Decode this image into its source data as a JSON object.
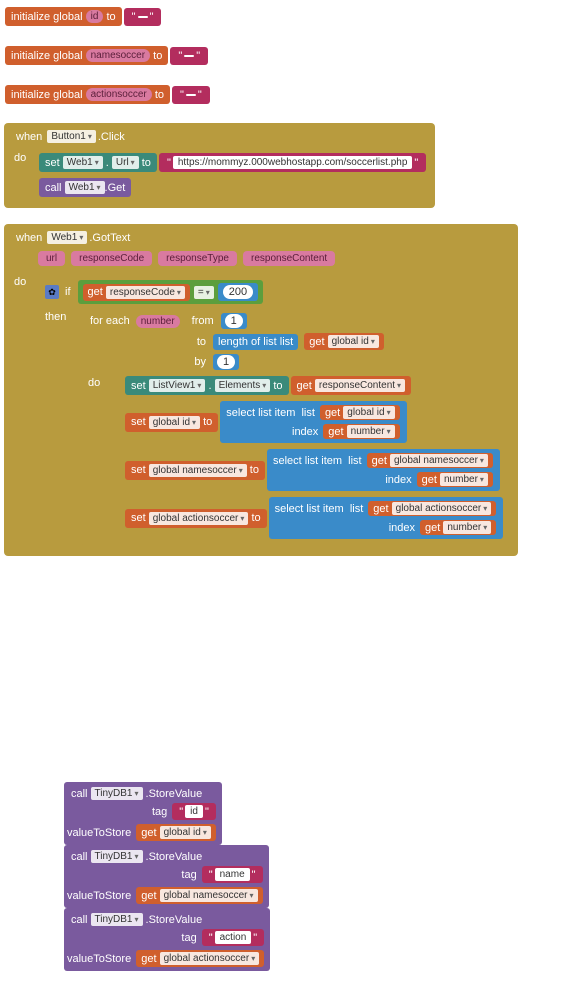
{
  "init": [
    {
      "label": "initialize global",
      "var": "id",
      "to": "to",
      "value": ""
    },
    {
      "label": "initialize global",
      "var": "namesoccer",
      "to": "to",
      "value": ""
    },
    {
      "label": "initialize global",
      "var": "actionsoccer",
      "to": "to",
      "value": ""
    }
  ],
  "event1": {
    "when": "when",
    "target": "Button1",
    "evt": ".Click",
    "do": "do",
    "set": "set",
    "web": "Web1",
    "prop": "Url",
    "to": "to",
    "url": "https://mommyz.000webhostapp.com/soccerlist.php",
    "call": "call",
    "callWeb": "Web1",
    "method": ".Get"
  },
  "event2": {
    "when": "when",
    "target": "Web1",
    "evt": ".GotText",
    "do": "do",
    "params": [
      "url",
      "responseCode",
      "responseType",
      "responseContent"
    ],
    "if": "if",
    "then": "then",
    "get": "get",
    "rc": "responseCode",
    "eq": "=",
    "n200": "200",
    "foreach": "for each",
    "numvar": "number",
    "from": "from",
    "tolbl": "to",
    "by": "by",
    "one": "1",
    "lenlist": "length of list",
    "list": "list",
    "getgi": "global id",
    "dolbl": "do",
    "setlv": "set",
    "lv": "ListView1",
    "lvprop": "Elements",
    "lvto": "to",
    "getrc": "responseContent",
    "rows": [
      {
        "set": "set",
        "var": "global id",
        "to": "to",
        "sli": "select list item",
        "list": "list",
        "getvar": "global id",
        "index": "index",
        "getnum": "number"
      },
      {
        "set": "set",
        "var": "global namesoccer",
        "to": "to",
        "sli": "select list item",
        "list": "list",
        "getvar": "global namesoccer",
        "index": "index",
        "getnum": "number"
      },
      {
        "set": "set",
        "var": "global actionsoccer",
        "to": "to",
        "sli": "select list item",
        "list": "list",
        "getvar": "global actionsoccer",
        "index": "index",
        "getnum": "number"
      }
    ]
  },
  "calls": [
    {
      "call": "call",
      "db": "TinyDB1",
      "method": ".StoreValue",
      "taglbl": "tag",
      "tag": "id",
      "vtslbl": "valueToStore",
      "get": "get",
      "var": "global id"
    },
    {
      "call": "call",
      "db": "TinyDB1",
      "method": ".StoreValue",
      "taglbl": "tag",
      "tag": "name",
      "vtslbl": "valueToStore",
      "get": "get",
      "var": "global namesoccer"
    },
    {
      "call": "call",
      "db": "TinyDB1",
      "method": ".StoreValue",
      "taglbl": "tag",
      "tag": "action",
      "vtslbl": "valueToStore",
      "get": "get",
      "var": "global actionsoccer"
    }
  ]
}
